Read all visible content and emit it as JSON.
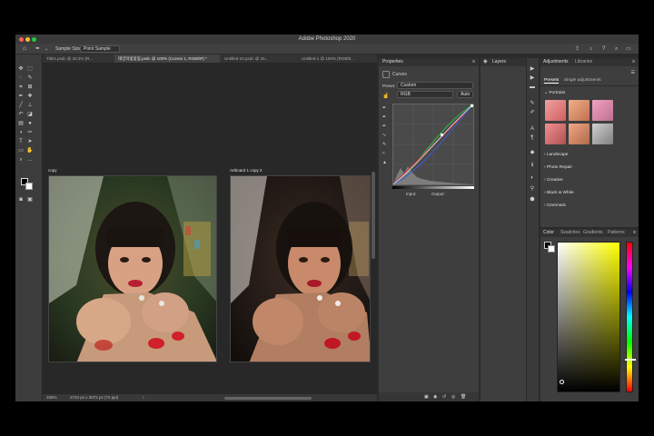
{
  "window": {
    "title": "Adobe Photoshop 2020"
  },
  "options_bar": {
    "sample_size_label": "Sample Size:",
    "sample_size_value": "Point Sample"
  },
  "doc_tabs": [
    "Title1.psdc @ 33.3% (R...",
    "태양의빛빛빛.psdc @ 100% (Curves 1, RGB/8#) *",
    "Untitled-22.psdc @ 25...",
    "Untitled-1 @ 100% (RGB/8..."
  ],
  "artboards": [
    {
      "label": "copy"
    },
    {
      "label": "Artboard 1 copy 2"
    }
  ],
  "status": {
    "zoom": "100%",
    "doc_info": "2734 px x 3072 px (72 ppi)"
  },
  "properties": {
    "title": "Properties",
    "section": "Curves",
    "preset_label": "Preset:",
    "preset_value": "Custom",
    "channel_value": "RGB",
    "auto_label": "Auto",
    "input_label": "Input:",
    "output_label": "Output:"
  },
  "layers": {
    "title": "Layers"
  },
  "adjustments": {
    "tabs": [
      "Adjustments",
      "Libraries"
    ],
    "subtabs": [
      "Presets",
      "Single adjustments"
    ],
    "groups": [
      "Portraits",
      "Landscape",
      "Photo Repair",
      "Creative",
      "Black & White",
      "Cinematic"
    ]
  },
  "color": {
    "tabs": [
      "Color",
      "Swatches",
      "Gradients",
      "Patterns"
    ]
  },
  "colors": {
    "accent": "#3d80e0",
    "bg": "#2b2b2b",
    "panel": "#3e3e3e"
  }
}
